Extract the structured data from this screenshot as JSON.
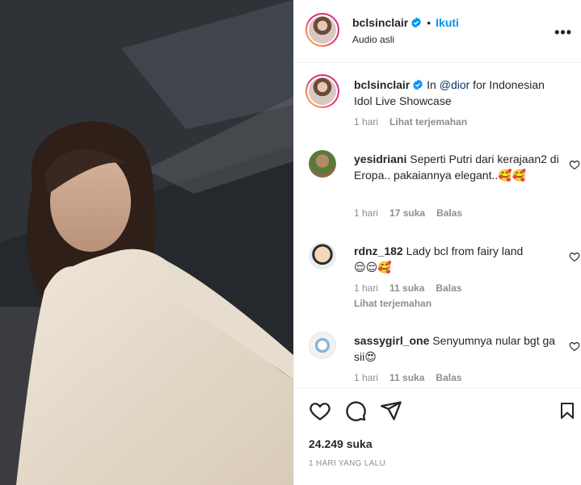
{
  "post": {
    "username": "bclsinclair",
    "follow_label": "Ikuti",
    "separator": "•",
    "audio": "Audio asli",
    "more_label": "•••"
  },
  "caption": {
    "username": "bclsinclair",
    "prefix": "In ",
    "mention": "@dior",
    "text": " for Indonesian Idol Live Showcase",
    "time": "1 hari",
    "translate": "Lihat terjemahan"
  },
  "comments": [
    {
      "username": "yesidriani",
      "text": "Seperti Putri dari kerajaan2 di Eropa.. pakaiannya elegant..",
      "emoji": "🥰🥰",
      "time": "1 hari",
      "likes": "17 suka",
      "reply": "Balas"
    },
    {
      "username": "rdnz_182",
      "text": "Lady bcl from fairy land",
      "emoji": "😌😌🥰",
      "time": "1 hari",
      "likes": "11 suka",
      "reply": "Balas",
      "translate": "Lihat terjemahan"
    },
    {
      "username": "sassygirl_one",
      "text": "Senyumnya nular bgt ga sii",
      "emoji": "😍",
      "time": "1 hari",
      "likes": "11 suka",
      "reply": "Balas"
    }
  ],
  "footer": {
    "likes": "24.249 suka",
    "ago": "1 HARI YANG LALU"
  },
  "icons": {
    "like": "heart-icon",
    "comment": "comment-icon",
    "share": "send-icon",
    "save": "bookmark-icon",
    "verified": "verified-badge-icon"
  },
  "colors": {
    "link": "#0095f6",
    "mention": "#00376b",
    "muted": "#8e8e8e",
    "verified": "#0095f6"
  }
}
